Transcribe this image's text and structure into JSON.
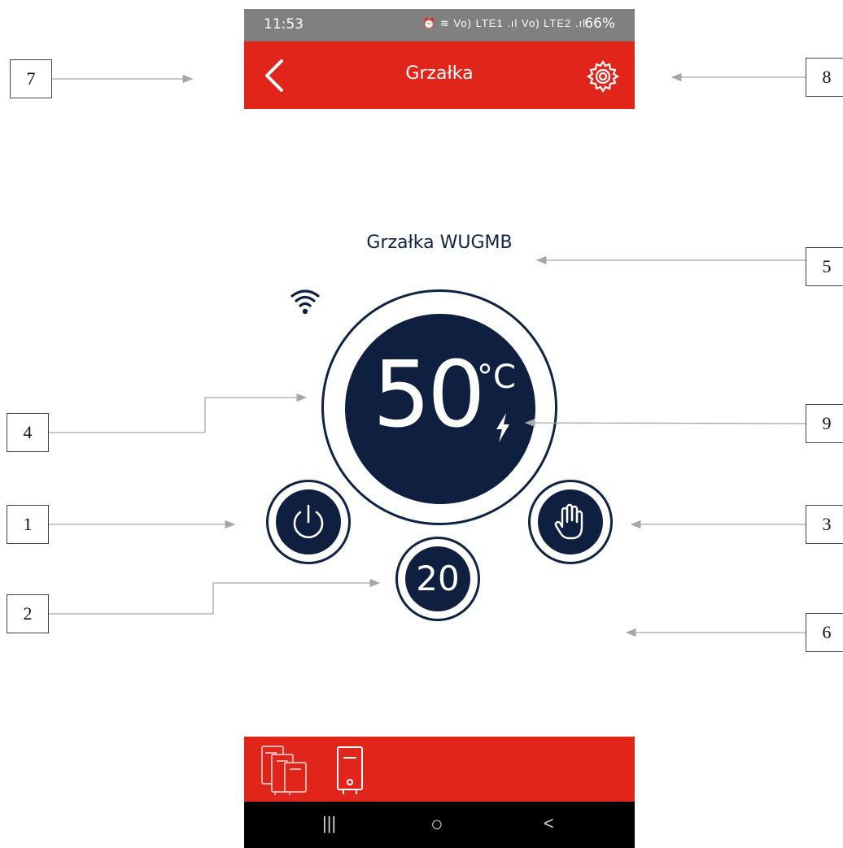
{
  "status_bar": {
    "time": "11:53",
    "icons": "⏰ ≋ Vo) LTE1 .ıl Vo) LTE2 .ıl",
    "battery": "66%"
  },
  "app_bar": {
    "title": "Grzałka",
    "back_icon": "chevron-left-icon",
    "settings_icon": "gear-icon"
  },
  "device": {
    "name": "Grzałka WUGMB",
    "wifi_icon": "wifi-icon"
  },
  "thermostat": {
    "current_temp": "50",
    "unit": "°C",
    "heating_icon": "lightning-bolt-icon"
  },
  "controls": {
    "power_icon": "power-icon",
    "manual_mode_icon": "hand-icon",
    "set_temp": "20"
  },
  "bottom_bar": {
    "icons": [
      "multi-heater-icon",
      "single-heater-icon"
    ]
  },
  "nav_bar": {
    "recents": "|||",
    "home": "○",
    "back": "<"
  },
  "annotations": {
    "callouts": [
      "7",
      "8",
      "5",
      "4",
      "9",
      "1",
      "3",
      "2",
      "6"
    ]
  },
  "colors": {
    "accent_red": "#e1251b",
    "navy": "#0e1f3f",
    "status_grey": "#808080"
  }
}
